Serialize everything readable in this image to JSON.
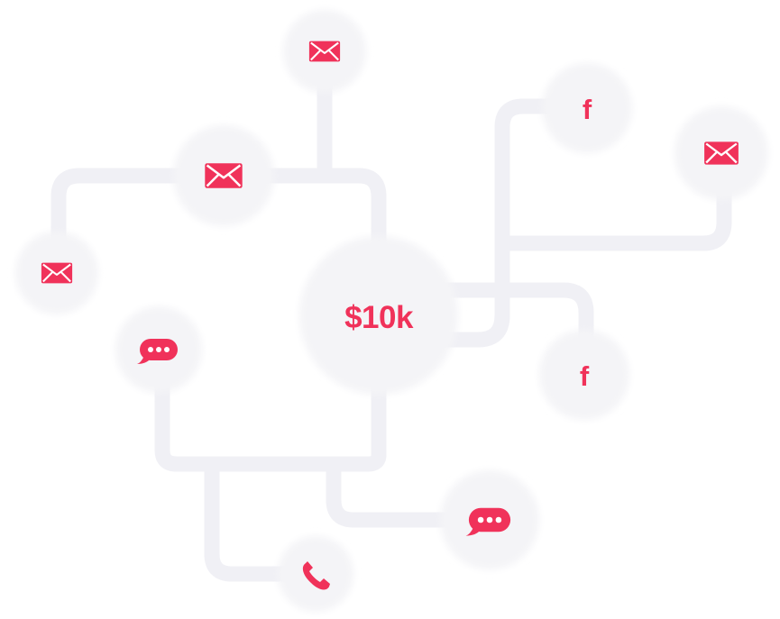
{
  "center": {
    "label": "$10k"
  },
  "nodes": [
    {
      "id": "email-top",
      "icon": "envelope-icon"
    },
    {
      "id": "email-upper-left",
      "icon": "envelope-icon"
    },
    {
      "id": "email-left",
      "icon": "envelope-icon"
    },
    {
      "id": "chat-left",
      "icon": "chat-bubble-icon"
    },
    {
      "id": "phone-bottom",
      "icon": "phone-icon"
    },
    {
      "id": "chat-bottom-right",
      "icon": "chat-bubble-icon"
    },
    {
      "id": "facebook-right-lower",
      "icon": "facebook-icon",
      "glyph": "f"
    },
    {
      "id": "facebook-top-right",
      "icon": "facebook-icon",
      "glyph": "f"
    },
    {
      "id": "email-right",
      "icon": "envelope-icon"
    }
  ],
  "colors": {
    "accent": "#f0325a",
    "node_fill": "#f4f4f7",
    "connector": "#f0f0f5",
    "background": "#ffffff"
  }
}
